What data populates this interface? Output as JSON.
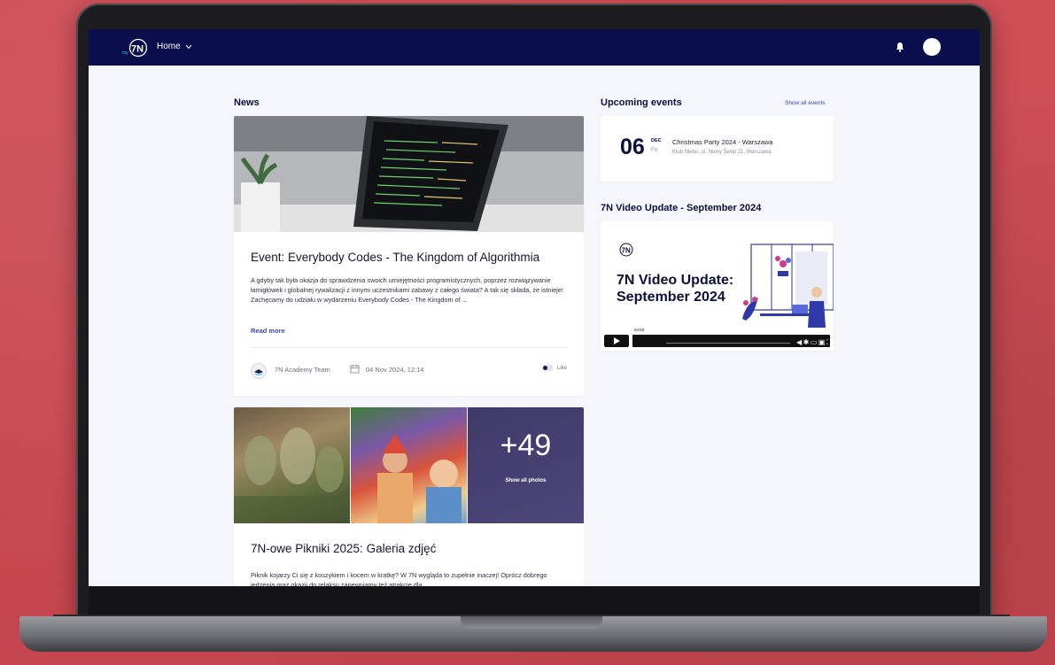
{
  "topbar": {
    "logo_icon": "7n-logo-icon",
    "home_label": "Home",
    "bell_icon": "bell-icon",
    "avatar": "avatar"
  },
  "news": {
    "section_title": "News",
    "posts": [
      {
        "title": "Event: Everybody Codes - The Kingdom of Algorithmia",
        "excerpt": "A gdyby tak była okazja do sprawdzenia swoich umiejętności programistycznych, poprzez rozwiązywanie łamigłówek i globalnej rywalizacji z innymi uczestnikami zabawy z całego świata? A tak się składa, że istnieje! Zachęcamy do udziału w wydarzeniu Everybody Codes - The Kingdom of ...",
        "read_more": "Read more",
        "author": "7N Academy Team",
        "date": "04 Nov 2024, 12:14",
        "like_label": "Like"
      },
      {
        "title": "7N-owe Pikniki 2025: Galeria zdjęć",
        "photo_count": "+49",
        "show_all_photos": "Show all photos",
        "excerpt": "Piknik kojarzy Ci się z koszykiem i kocem w kratkę? W 7N wygląda to zupełnie inaczej! Oprócz dobrego jedzenia oraz okazji do relaksu zapewniamy też atrakcje dla..."
      }
    ]
  },
  "events": {
    "section_title": "Upcoming events",
    "show_all": "Show all events",
    "items": [
      {
        "day": "06",
        "month": "DEC",
        "weekday": "Fri",
        "title": "Christmas Party 2024 - Warszawa",
        "location": "Klub Niebo, ul. Nowy Świat 21, Warszawa"
      }
    ]
  },
  "video": {
    "section_title": "7N Video Update - September 2024",
    "heading_line1": "7N Video Update:",
    "heading_line2": "September 2024",
    "time": "04:50",
    "accent": "#2f3aa8"
  },
  "colors": {
    "navbar": "#0a0e4d",
    "accent": "#3a47b8",
    "background": "#f4f6fb"
  }
}
